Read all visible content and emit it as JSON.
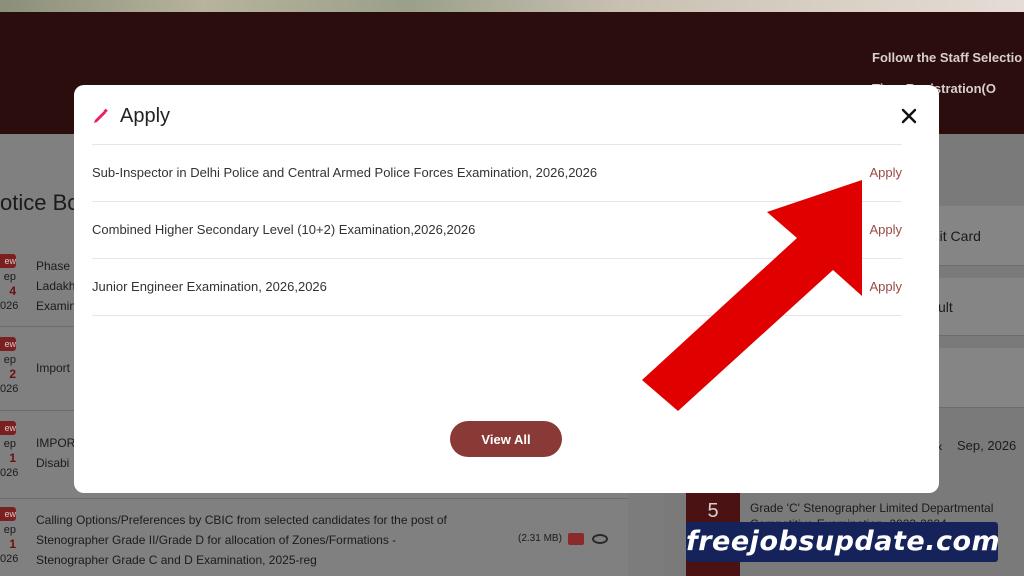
{
  "background": {
    "marquee": [
      "Follow the Staff Selectio",
      "Time Registration(O"
    ],
    "notice_board": {
      "title": "otice Bo",
      "rows": [
        {
          "new": "ew",
          "month": "ep",
          "day": "4",
          "year": "026",
          "text": "Phase\nLadakh\nExamin"
        },
        {
          "new": "ew",
          "month": "ep",
          "day": "2",
          "year": "026",
          "text": "Import"
        },
        {
          "new": "ew",
          "month": "ep",
          "day": "1",
          "year": "026",
          "text": "IMPOR\nDisabi"
        },
        {
          "new": "ew",
          "month": "ep",
          "day": "1",
          "year": "026",
          "text": "Calling Options/Preferences by CBIC from selected candidates for the post of\nStenographer Grade II/Grade D for allocation of Zones/Formations -\nStenographer Grade C and D Examination, 2025-reg",
          "size": "(2.31 MB)"
        }
      ]
    },
    "right_panel": {
      "admit_card": "mit Card",
      "result": "ult",
      "calendar_month": "Sep, 2026",
      "calendar_day": "5",
      "event_text": "Grade 'C' Stenographer Limited Departmental\nCompetitive Examination, 2023-2024"
    }
  },
  "modal": {
    "title": "Apply",
    "close_label": "×",
    "exams": [
      {
        "name": "Sub-Inspector in Delhi Police and Central Armed Police Forces Examination, 2026,2026",
        "action": "Apply"
      },
      {
        "name": "Combined Higher Secondary Level (10+2) Examination,2026,2026",
        "action": "Apply"
      },
      {
        "name": "Junior Engineer Examination, 2026,2026",
        "action": "Apply"
      }
    ],
    "view_all_label": "View All"
  },
  "watermark": "freejobsupdate.com",
  "colors": {
    "brand": "#8a3a36",
    "apply_link": "#9a4a46",
    "arrow": "#e00000",
    "pencil": "#e91e63",
    "watermark_bg": "#16235b"
  },
  "icons": [
    "pencil-icon",
    "close-icon",
    "pdf-icon",
    "eye-icon",
    "chevron-left-icon"
  ]
}
